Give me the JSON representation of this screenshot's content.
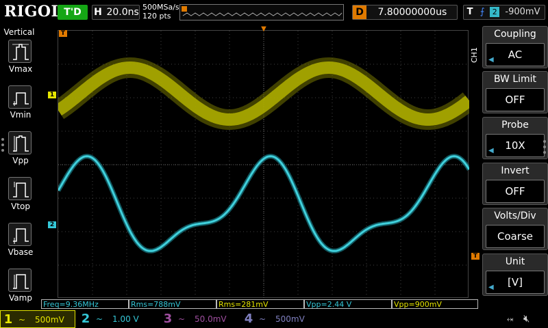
{
  "topbar": {
    "logo": "RIGOL",
    "run_status": "T'D",
    "horizontal_label": "H",
    "timebase": "20.0ns",
    "sample_rate": "500MSa/s",
    "points": "120 pts",
    "delay_label": "D",
    "delay_value": "7.80000000us",
    "trigger_label": "T",
    "trigger_channel": "2",
    "trigger_level": "-900mV"
  },
  "left_panel": {
    "title": "Vertical",
    "items": [
      {
        "label": "Vmax",
        "icon": "vmax-icon"
      },
      {
        "label": "Vmin",
        "icon": "vmin-icon"
      },
      {
        "label": "Vpp",
        "icon": "vpp-icon"
      },
      {
        "label": "Vtop",
        "icon": "vtop-icon"
      },
      {
        "label": "Vbase",
        "icon": "vbase-icon"
      },
      {
        "label": "Vamp",
        "icon": "vamp-icon"
      }
    ]
  },
  "right_panel": {
    "channel_tag": "CH1",
    "buttons": [
      {
        "title": "Coupling",
        "value": "AC"
      },
      {
        "title": "BW Limit",
        "value": "OFF"
      },
      {
        "title": "Probe",
        "value": "10X"
      },
      {
        "title": "Invert",
        "value": "OFF"
      },
      {
        "title": "Volts/Div",
        "value": "Coarse"
      },
      {
        "title": "Unit",
        "value": "[V]"
      }
    ]
  },
  "markers": {
    "trigger_pos": "T",
    "ch1": "1",
    "ch2": "2",
    "trigger_level": "T"
  },
  "measurements": [
    {
      "text": "Freq=9.36MHz",
      "color": "cyan"
    },
    {
      "text": "Rms=788mV",
      "color": "cyan"
    },
    {
      "text": "Rms=281mV",
      "color": "yellow"
    },
    {
      "text": "Vpp=2.44 V",
      "color": "cyan"
    },
    {
      "text": "Vpp=900mV",
      "color": "yellow"
    }
  ],
  "channels": [
    {
      "num": "1",
      "coupling": "~",
      "scale": "500mV",
      "color": "#e6e600"
    },
    {
      "num": "2",
      "coupling": "~",
      "scale": "1.00 V",
      "color": "#35c8d8"
    },
    {
      "num": "3",
      "coupling": "~",
      "scale": "50.0mV",
      "color": "#a04fa0"
    },
    {
      "num": "4",
      "coupling": "~",
      "scale": "500mV",
      "color": "#8080c0"
    }
  ],
  "colors": {
    "ch1": "#e6e600",
    "ch2": "#35c8d8",
    "trigger": "#e07a00",
    "run_status_bg": "#15a615"
  }
}
